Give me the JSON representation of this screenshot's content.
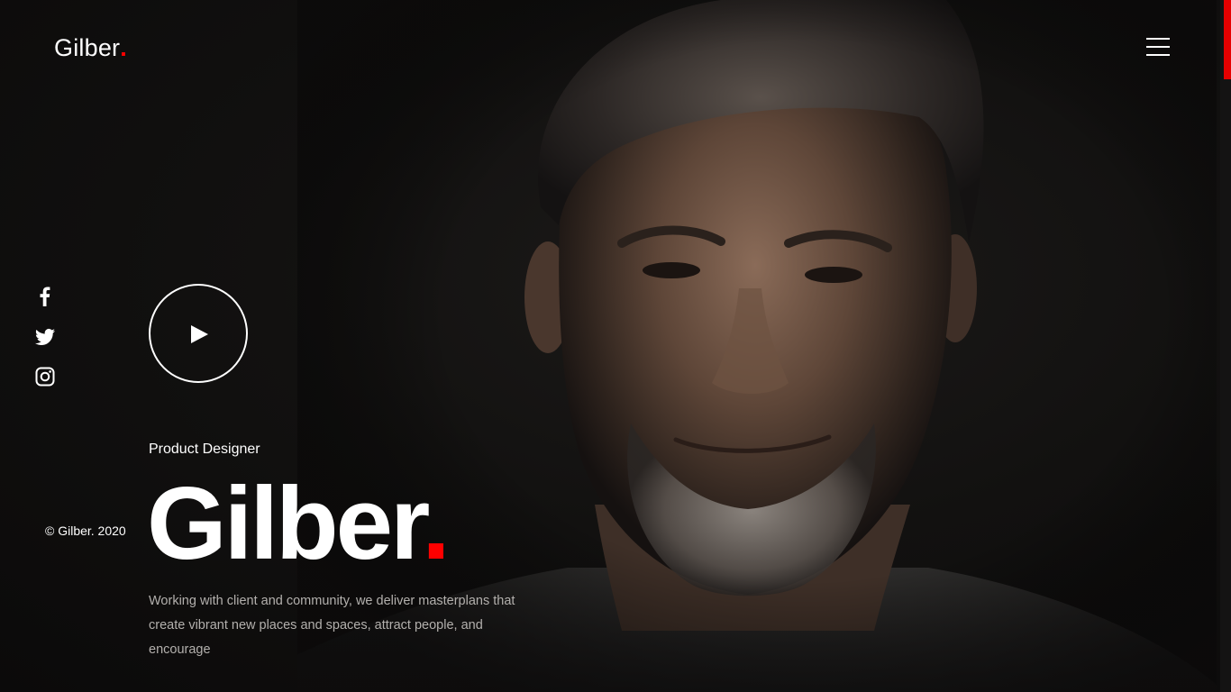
{
  "header": {
    "brand_text": "Gilber",
    "brand_dot": ".",
    "menu_icon": "hamburger-menu-icon"
  },
  "social": [
    {
      "icon": "facebook-icon"
    },
    {
      "icon": "twitter-icon"
    },
    {
      "icon": "instagram-icon"
    }
  ],
  "hero": {
    "play_icon": "play-icon",
    "role": "Product Designer",
    "name": "Gilber",
    "name_dot": ".",
    "description": "Working with client and community, we deliver masterplans that create vibrant new places and spaces, attract people, and encourage"
  },
  "footer": {
    "copyright": "© Gilber. 2020"
  },
  "colors": {
    "accent": "#ff0000",
    "background": "#0d0c0c",
    "text": "#ffffff",
    "muted_text": "#b3b0ad"
  }
}
